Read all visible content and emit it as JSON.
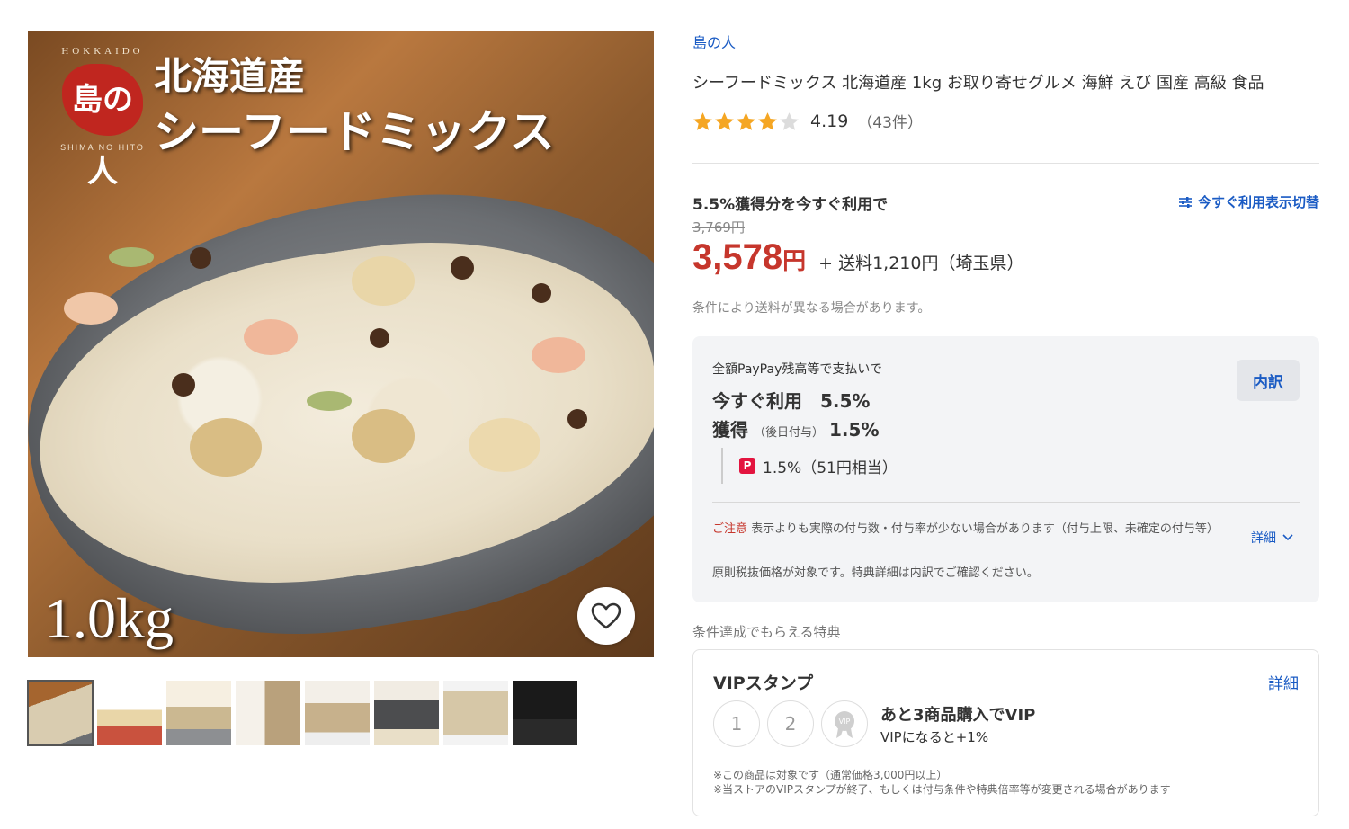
{
  "image": {
    "brand_hokkaido": "HOKKAIDO",
    "brand_seal": "島の人",
    "brand_shima": "SHIMA NO HITO",
    "title_line1": "北海道産",
    "title_line2": "シーフードミックス",
    "weight": "1.0kg"
  },
  "thumbnails": [
    {
      "name": "thumb-1"
    },
    {
      "name": "thumb-2"
    },
    {
      "name": "thumb-3"
    },
    {
      "name": "thumb-4"
    },
    {
      "name": "thumb-5"
    },
    {
      "name": "thumb-6"
    },
    {
      "name": "thumb-7"
    },
    {
      "name": "thumb-8"
    }
  ],
  "product": {
    "store": "島の人",
    "title": "シーフードミックス 北海道産 1kg お取り寄せグルメ 海鮮 えび 国産 高級 食品",
    "rating": "4.19",
    "rating_stars": 4.19,
    "review_count": "（43件）"
  },
  "pricing": {
    "use_now_label": "5.5%獲得分を今すぐ利用で",
    "toggle_label": "今すぐ利用表示切替",
    "original_price": "3,769円",
    "price": "3,578",
    "price_unit": "円",
    "shipping": "+ 送料1,210円（埼玉県）",
    "shipping_note": "条件により送料が異なる場合があります。"
  },
  "paypay": {
    "label": "全額PayPay残高等で支払いで",
    "use_now": "今すぐ利用　5.5%",
    "earn_label": "獲得",
    "earn_note": "（後日付与）",
    "earn_value": "1.5%",
    "breakdown_button": "内訳",
    "paypay_value": "1.5%（51円相当）",
    "caution_label": "ご注意",
    "caution_text": "表示よりも実際の付与数・付与率が少ない場合があります（付与上限、未確定の付与等）",
    "details_link": "詳細",
    "tax_note": "原則税抜価格が対象です。特典詳細は内訳でご確認ください。"
  },
  "bonus": {
    "label": "条件達成でもらえる特典",
    "vip_title": "VIPスタンプ",
    "vip_detail": "詳細",
    "stamp1": "1",
    "stamp2": "2",
    "vip_badge": "VIP",
    "vip_main": "あと3商品購入でVIP",
    "vip_sub": "VIPになると+1%",
    "note1": "※この商品は対象です（通常価格3,000円以上）",
    "note2": "※当ストアのVIPスタンプが終了、もしくは付与条件や特典倍率等が変更される場合があります"
  },
  "colors": {
    "link": "#1a5bc4",
    "price": "#c6362c",
    "star": "#f5a623",
    "paypay": "#e3143f"
  }
}
